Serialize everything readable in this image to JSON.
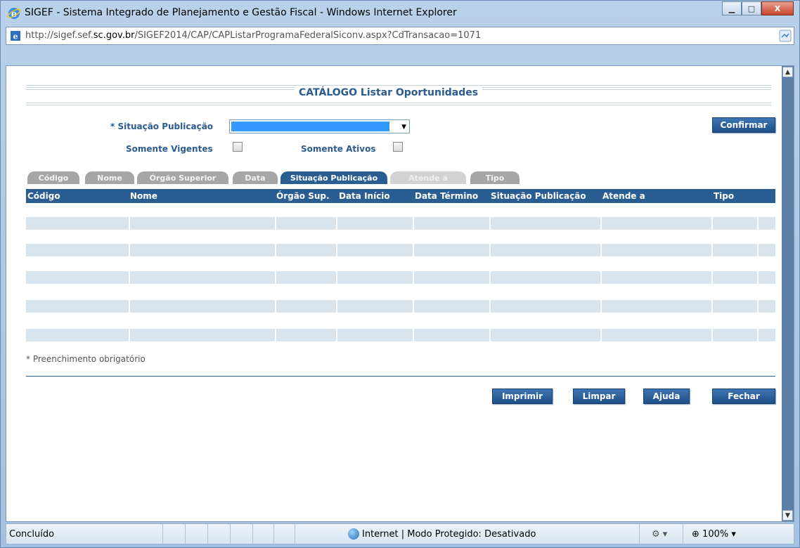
{
  "window": {
    "title": "SIGEF - Sistema Integrado de Planejamento e Gestão Fiscal - Windows Internet Explorer",
    "minimize": "▁",
    "maximize": "□",
    "close": "X"
  },
  "address": {
    "prefix": "http://sigef.sef.",
    "domain": "sc.gov.br",
    "path": "/SIGEF2014/CAP/CAPListarProgramaFederalSiconv.aspx?CdTransacao=1071"
  },
  "page": {
    "title": "CATÁLOGO Listar Oportunidades",
    "situacao_label": "* Situação Publicação",
    "vigentes_label": "Somente Vigentes",
    "ativos_label": "Somente Ativos",
    "confirm_label": "Confirmar"
  },
  "tabs": [
    {
      "label": "Código",
      "state": "inactive"
    },
    {
      "label": "Nome",
      "state": "inactive"
    },
    {
      "label": "Órgão Superior",
      "state": "inactive"
    },
    {
      "label": "Data",
      "state": "inactive"
    },
    {
      "label": "Situação Publicação",
      "state": "active"
    },
    {
      "label": "Atende a",
      "state": "dim"
    },
    {
      "label": "Tipo",
      "state": "inactive"
    }
  ],
  "grid": {
    "columns": [
      "Código",
      "Nome",
      "Órgão Sup.",
      "Data Início",
      "Data Término",
      "Situação Publicação",
      "Atende a",
      "Tipo"
    ],
    "empty_rows": 5
  },
  "footer": {
    "note": "* Preenchimento obrigatório",
    "buttons": [
      "Imprimir",
      "Limpar",
      "Ajuda",
      "Fechar"
    ]
  },
  "statusbar": {
    "status": "Concluído",
    "zone": "Internet | Modo Protegido: Desativado",
    "zoom": "100%"
  },
  "colors": {
    "header_blue": "#2a5d92",
    "row_fill": "#d8e5ef",
    "select_highlight": "#3399ff"
  }
}
